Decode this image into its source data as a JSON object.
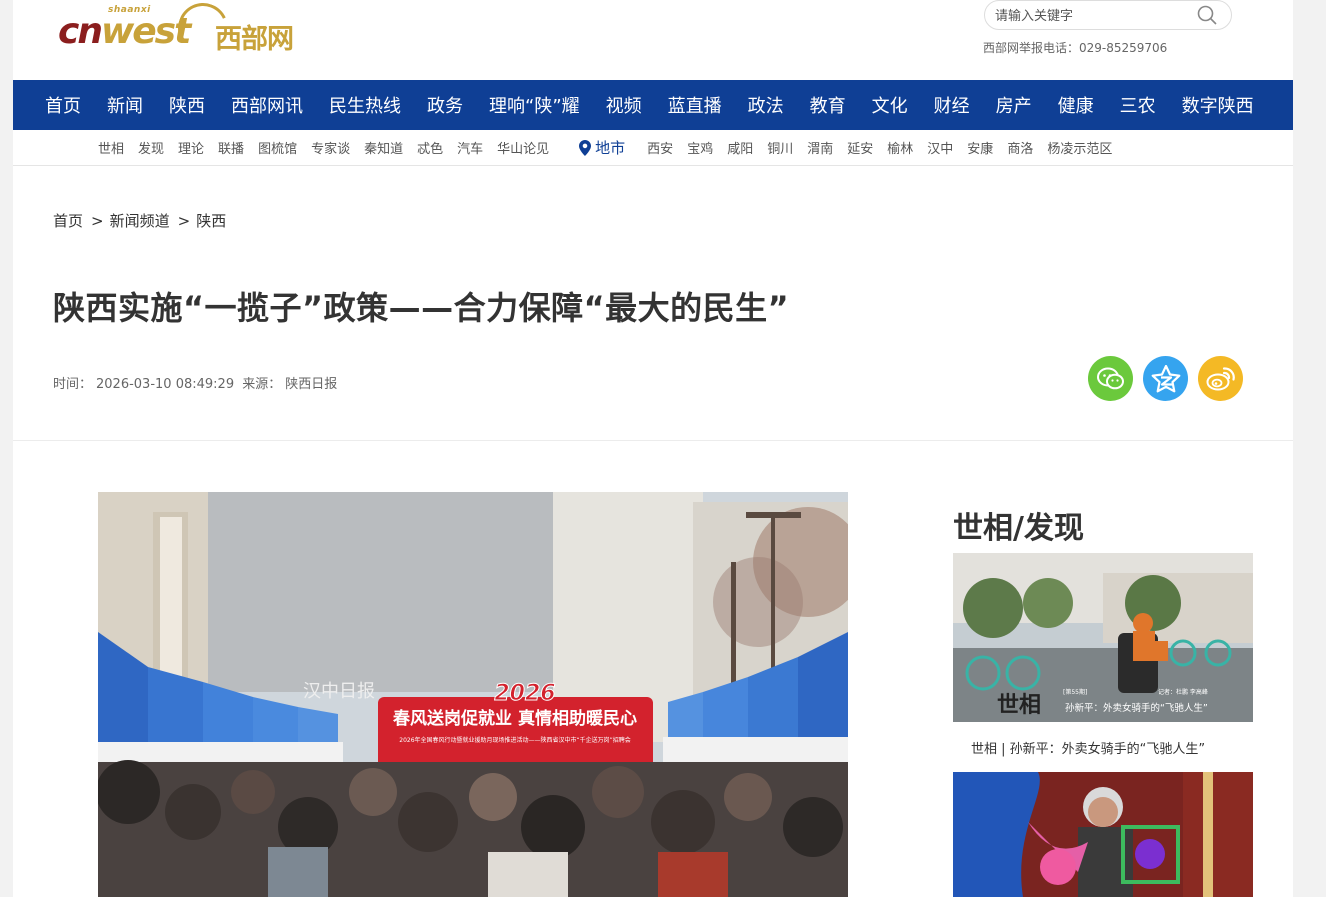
{
  "header": {
    "logo_sub": "shaanxi",
    "logo_main_a": "cn",
    "logo_main_b": "west",
    "logo_cn": "西部网",
    "search_placeholder": "请输入关键字",
    "hotline": "西部网举报电话：029-85259706"
  },
  "nav": {
    "items": [
      "首页",
      "新闻",
      "陕西",
      "西部网讯",
      "民生热线",
      "政务",
      "理响“陕”耀",
      "视频",
      "蓝直播",
      "政法",
      "教育",
      "文化",
      "财经",
      "房产",
      "健康",
      "三农",
      "数字陕西"
    ]
  },
  "subnav": {
    "items": [
      "世相",
      "发现",
      "理论",
      "联播",
      "图梳馆",
      "专家谈",
      "秦知道",
      "忒色",
      "汽车",
      "华山论见"
    ],
    "local_label": "地市",
    "cities": [
      "西安",
      "宝鸡",
      "咸阳",
      "铜川",
      "渭南",
      "延安",
      "榆林",
      "汉中",
      "安康",
      "商洛",
      "杨凌示范区"
    ]
  },
  "breadcrumb": {
    "home": "首页",
    "sep": ">",
    "channel": "新闻频道",
    "section": "陕西"
  },
  "article": {
    "title": "陕西实施“一揽子”政策——合力保障“最大的民生”",
    "time_label": "时间：",
    "time": "2026-03-10 08:49:29",
    "source_label": "来源：",
    "source": "陕西日报"
  },
  "photo": {
    "banner_year": "2026",
    "banner_main": "春风送岗促就业 真情相助暖民心",
    "banner_sub": "2026年全国春风行动暨就业援助月现场推进活动——陕西省汉中市“千企送万岗”招聘会",
    "building_sign": "汉中日报"
  },
  "sidebar": {
    "title": "世相/发现",
    "caption1": "世相 | 孙新平：外卖女骑手的“飞驰人生”",
    "img1_logo": "世相",
    "img1_overlay": "孙新平：外卖女骑手的“飞驰人生”",
    "img1_issue": "[第55期]",
    "img1_credit": "记者：杜鹏 李高峰"
  },
  "colors": {
    "nav_bg": "#0f3f95",
    "wechat": "#6bc93c",
    "qzone": "#35a4ef",
    "weibo": "#f4b925",
    "logo_red": "#8b1e1e",
    "logo_gold": "#c8a23a"
  }
}
